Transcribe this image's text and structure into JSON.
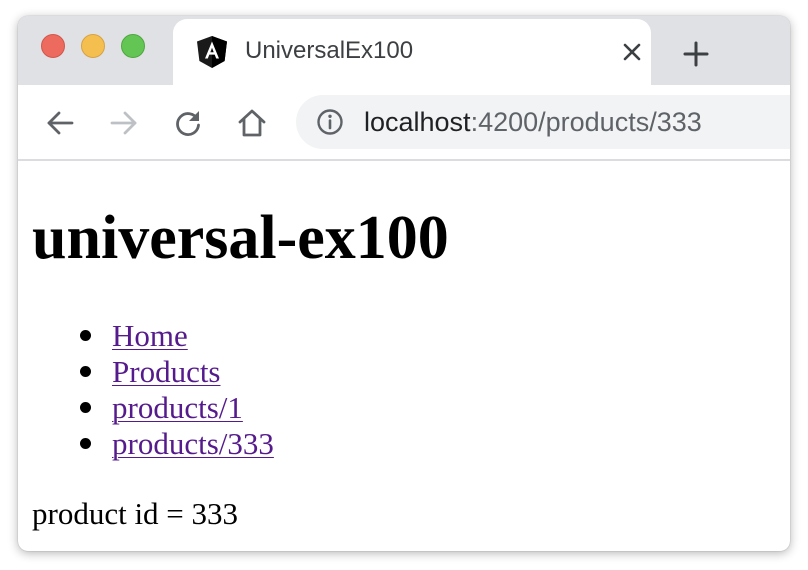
{
  "browser": {
    "tab": {
      "title": "UniversalEx100",
      "favicon": "angular-logo-icon"
    },
    "toolbar": {
      "url_host": "localhost",
      "url_rest": ":4200/products/333"
    }
  },
  "page": {
    "heading": "universal-ex100",
    "links": [
      {
        "label": "Home"
      },
      {
        "label": "Products"
      },
      {
        "label": "products/1"
      },
      {
        "label": "products/333"
      }
    ],
    "product_label": "product id = 333"
  },
  "colors": {
    "tabstrip": "#dfe1e5",
    "omnibox": "#f1f3f4",
    "link_visited": "#551a8b",
    "traffic_red": "#ed6a5e",
    "traffic_yellow": "#f5bf4f",
    "traffic_green": "#62c554"
  }
}
